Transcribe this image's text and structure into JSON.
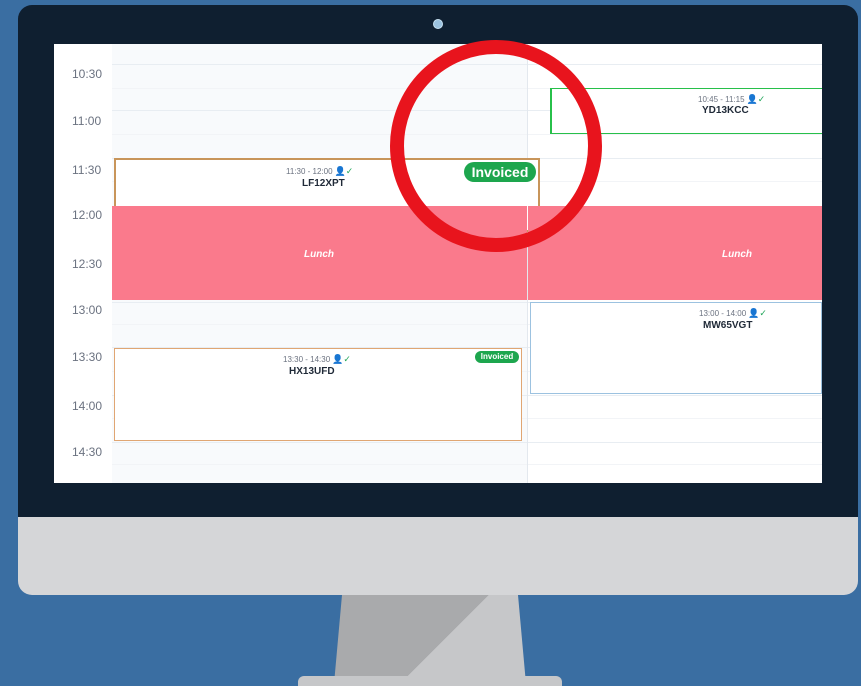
{
  "calendar": {
    "time_slots": [
      "10:30",
      "11:00",
      "11:30",
      "12:00",
      "12:30",
      "13:00",
      "13:30",
      "14:00",
      "14:30"
    ],
    "appointments": [
      {
        "time": "10:45 - 11:15",
        "registration": "YD13KCC",
        "status": "",
        "border_color": "#27c04a"
      },
      {
        "time": "11:30 - 12:00",
        "registration": "LF12XPT",
        "status": "Invoiced",
        "border_color": "#c8955a"
      },
      {
        "time": "13:00 - 14:00",
        "registration": "MW65VGT",
        "status": "",
        "border_color": "#9cc2e0"
      },
      {
        "time": "13:30 - 14:30",
        "registration": "HX13UFD",
        "status": "Invoiced",
        "border_color": "#e0a673"
      }
    ],
    "lunch_label": "Lunch"
  },
  "colors": {
    "lunch": "#fa7a8c",
    "invoiced_badge": "#1da64e",
    "highlight_ring": "#e8141d",
    "background": "#3a6ea2"
  },
  "icons": {
    "technician": "person-check-icon",
    "camera": "camera-icon"
  }
}
